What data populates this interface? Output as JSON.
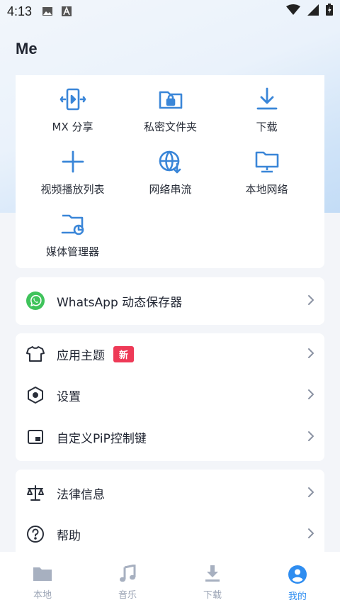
{
  "status_bar": {
    "time": "4:13"
  },
  "header": {
    "title": "Me"
  },
  "grid": [
    {
      "label": "MX 分享",
      "icon": "mx-share-icon"
    },
    {
      "label": "私密文件夹",
      "icon": "private-folder-icon"
    },
    {
      "label": "下载",
      "icon": "download-icon"
    },
    {
      "label": "视频播放列表",
      "icon": "plus-icon"
    },
    {
      "label": "网络串流",
      "icon": "network-stream-icon"
    },
    {
      "label": "本地网络",
      "icon": "local-network-icon"
    },
    {
      "label": "媒体管理器",
      "icon": "media-manager-icon"
    }
  ],
  "whatsapp": {
    "label": "WhatsApp 动态保存器"
  },
  "settings_group": [
    {
      "label": "应用主题",
      "badge": "新"
    },
    {
      "label": "设置"
    },
    {
      "label": "自定义PiP控制键"
    }
  ],
  "info_group": [
    {
      "label": "法律信息"
    },
    {
      "label": "帮助"
    }
  ],
  "bottom_nav": [
    {
      "label": "本地",
      "active": false
    },
    {
      "label": "音乐",
      "active": false
    },
    {
      "label": "下载",
      "active": false
    },
    {
      "label": "我的",
      "active": true
    }
  ],
  "colors": {
    "accent": "#2f8df0",
    "icon_blue": "#3a86d8",
    "badge": "#ee3a57",
    "whatsapp_green": "#3fc35b"
  }
}
